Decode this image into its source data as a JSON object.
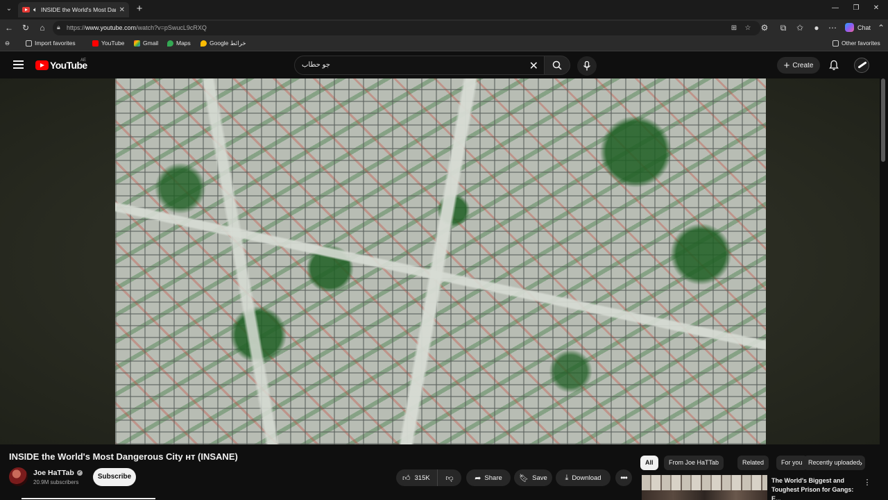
{
  "browser": {
    "tab_title": "INSIDE the World's Most Dangerous City нт (INSANE)",
    "url_prefix": "https://",
    "url_host": "www.youtube.com",
    "url_path": "/watch?v=pSwucL9cRXQ",
    "chat_label": "Chat",
    "bookmarks": [
      "Import favorites",
      "YouTube",
      "Gmail",
      "Maps",
      "Google خرائط"
    ],
    "other_favorites": "Other favorites"
  },
  "youtube": {
    "logo_text": "YouTube",
    "region": "AE",
    "search_query": "جو حطاب",
    "create_label": "Create"
  },
  "video": {
    "title": "INSIDE the World's Most Dangerous City нт (INSANE)",
    "channel": "Joe HaTTab",
    "subscribers": "20.9M subscribers",
    "subscribe_label": "Subscribe",
    "likes": "315K",
    "share_label": "Share",
    "save_label": "Save",
    "download_label": "Download"
  },
  "sidebar": {
    "chips": [
      "All",
      "From Joe HaTTab",
      "Related",
      "For you",
      "Recently uploaded"
    ],
    "recommendation": {
      "title": "The World's Biggest and Toughest Prison for Gangs: E..."
    }
  },
  "colors": {
    "youtube_red": "#ff0000",
    "background": "#0f0f0f",
    "pill_bg": "#272727"
  }
}
